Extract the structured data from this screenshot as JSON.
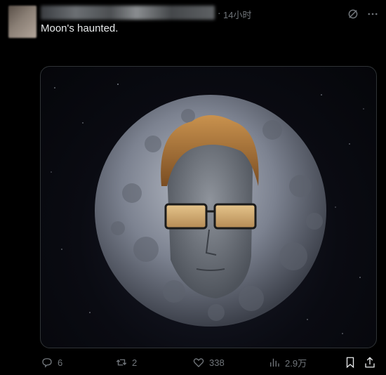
{
  "header": {
    "time": "14小时",
    "dot": "·"
  },
  "tweet": {
    "text": "Moon's haunted."
  },
  "actions": {
    "reply_count": "6",
    "retweet_count": "2",
    "like_count": "338",
    "views_count": "2.9万"
  },
  "icons": {
    "grok": "grok-icon",
    "more": "more-icon",
    "reply": "reply-icon",
    "retweet": "retweet-icon",
    "like": "heart-icon",
    "views": "views-icon",
    "bookmark": "bookmark-icon",
    "share": "share-icon"
  },
  "colors": {
    "background": "#000000",
    "text": "#e7e9ea",
    "muted": "#71767b",
    "border": "#2f3336"
  }
}
